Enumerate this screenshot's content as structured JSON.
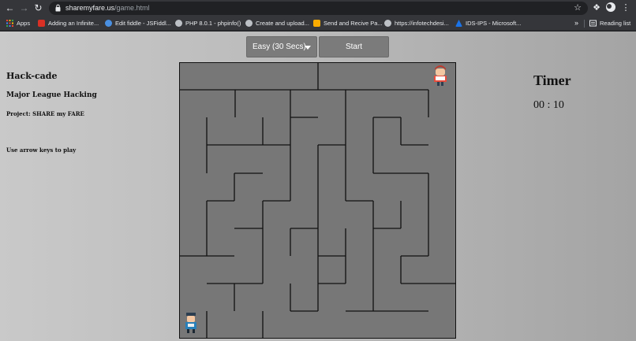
{
  "browser": {
    "url_host": "sharemyfare.us",
    "url_path": "/game.html",
    "bookmarks": [
      {
        "label": "Apps",
        "color": "#ea4335"
      },
      {
        "label": "Adding an Infinite...",
        "color": "#d93025"
      },
      {
        "label": "Edit fiddle - JSFiddl...",
        "color": "#4a90e2"
      },
      {
        "label": "PHP 8.0.1 - phpinfo()",
        "color": "#bdc1c6"
      },
      {
        "label": "Create and upload...",
        "color": "#bdc1c6"
      },
      {
        "label": "Send and Recive Pa...",
        "color": "#f9ab00"
      },
      {
        "label": "https://infotechdesi...",
        "color": "#bdc1c6"
      },
      {
        "label": "IDS-IPS - Microsoft...",
        "color": "#1a73e8"
      }
    ],
    "more_label": "»",
    "reading_list": "Reading list"
  },
  "game": {
    "difficulty": "Easy (30 Secs)",
    "start_label": "Start",
    "title": "Hack-cade",
    "subtitle": "Major League Hacking",
    "project": "Project: SHARE my FARE",
    "instructions": "Use arrow keys to play",
    "timer_title": "Timer",
    "timer_value": "00 : 10"
  },
  "colors": {
    "maze_bg": "#777777",
    "wall": "#111111"
  }
}
